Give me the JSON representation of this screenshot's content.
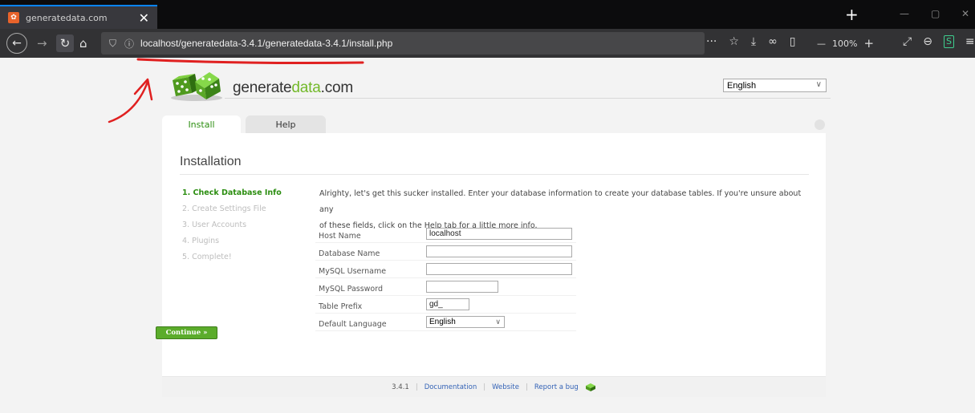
{
  "browser": {
    "tab_title": "generatedata.com",
    "tab_close": "✕",
    "new_tab": "+",
    "url": "localhost/generatedata-3.4.1/generatedata-3.4.1/install.php",
    "zoom": "100%",
    "window_controls": [
      "—",
      "▢",
      "✕"
    ]
  },
  "header": {
    "logo_text_main": "generate",
    "logo_text_accent": "data",
    "logo_text_suffix": ".com",
    "language": "English"
  },
  "tabs": {
    "install": "Install",
    "help": "Help"
  },
  "main": {
    "heading": "Installation",
    "steps": [
      "1. Check Database Info",
      "2. Create Settings File",
      "3. User Accounts",
      "4. Plugins",
      "5. Complete!"
    ],
    "intro_line1": "Alrighty, let's get this sucker installed. Enter your database information to create your database tables. If you're unsure about any",
    "intro_line2": "of these fields, click on the Help tab for a little more info.",
    "form": {
      "host_label": "Host Name",
      "host_value": "localhost",
      "dbname_label": "Database Name",
      "dbname_value": "",
      "user_label": "MySQL Username",
      "user_value": "",
      "pass_label": "MySQL Password",
      "pass_value": "",
      "prefix_label": "Table Prefix",
      "prefix_value": "gd_",
      "lang_label": "Default Language",
      "lang_value": "English"
    },
    "continue_label": "Continue »"
  },
  "footer": {
    "version": "3.4.1",
    "sep": "|",
    "documentation": "Documentation",
    "website": "Website",
    "report_bug": "Report a bug"
  },
  "colors": {
    "accent_green": "#73b92a",
    "link_blue": "#3463b6",
    "annotation_red": "#e02020"
  }
}
